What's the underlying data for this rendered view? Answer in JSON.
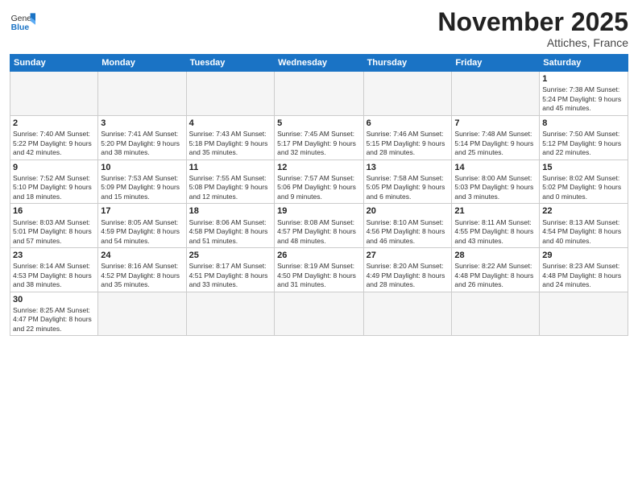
{
  "logo": {
    "text_general": "General",
    "text_blue": "Blue"
  },
  "header": {
    "month": "November 2025",
    "location": "Attiches, France"
  },
  "weekdays": [
    "Sunday",
    "Monday",
    "Tuesday",
    "Wednesday",
    "Thursday",
    "Friday",
    "Saturday"
  ],
  "weeks": [
    [
      {
        "day": "",
        "info": ""
      },
      {
        "day": "",
        "info": ""
      },
      {
        "day": "",
        "info": ""
      },
      {
        "day": "",
        "info": ""
      },
      {
        "day": "",
        "info": ""
      },
      {
        "day": "",
        "info": ""
      },
      {
        "day": "1",
        "info": "Sunrise: 7:38 AM\nSunset: 5:24 PM\nDaylight: 9 hours and 45 minutes."
      }
    ],
    [
      {
        "day": "2",
        "info": "Sunrise: 7:40 AM\nSunset: 5:22 PM\nDaylight: 9 hours and 42 minutes."
      },
      {
        "day": "3",
        "info": "Sunrise: 7:41 AM\nSunset: 5:20 PM\nDaylight: 9 hours and 38 minutes."
      },
      {
        "day": "4",
        "info": "Sunrise: 7:43 AM\nSunset: 5:18 PM\nDaylight: 9 hours and 35 minutes."
      },
      {
        "day": "5",
        "info": "Sunrise: 7:45 AM\nSunset: 5:17 PM\nDaylight: 9 hours and 32 minutes."
      },
      {
        "day": "6",
        "info": "Sunrise: 7:46 AM\nSunset: 5:15 PM\nDaylight: 9 hours and 28 minutes."
      },
      {
        "day": "7",
        "info": "Sunrise: 7:48 AM\nSunset: 5:14 PM\nDaylight: 9 hours and 25 minutes."
      },
      {
        "day": "8",
        "info": "Sunrise: 7:50 AM\nSunset: 5:12 PM\nDaylight: 9 hours and 22 minutes."
      }
    ],
    [
      {
        "day": "9",
        "info": "Sunrise: 7:52 AM\nSunset: 5:10 PM\nDaylight: 9 hours and 18 minutes."
      },
      {
        "day": "10",
        "info": "Sunrise: 7:53 AM\nSunset: 5:09 PM\nDaylight: 9 hours and 15 minutes."
      },
      {
        "day": "11",
        "info": "Sunrise: 7:55 AM\nSunset: 5:08 PM\nDaylight: 9 hours and 12 minutes."
      },
      {
        "day": "12",
        "info": "Sunrise: 7:57 AM\nSunset: 5:06 PM\nDaylight: 9 hours and 9 minutes."
      },
      {
        "day": "13",
        "info": "Sunrise: 7:58 AM\nSunset: 5:05 PM\nDaylight: 9 hours and 6 minutes."
      },
      {
        "day": "14",
        "info": "Sunrise: 8:00 AM\nSunset: 5:03 PM\nDaylight: 9 hours and 3 minutes."
      },
      {
        "day": "15",
        "info": "Sunrise: 8:02 AM\nSunset: 5:02 PM\nDaylight: 9 hours and 0 minutes."
      }
    ],
    [
      {
        "day": "16",
        "info": "Sunrise: 8:03 AM\nSunset: 5:01 PM\nDaylight: 8 hours and 57 minutes."
      },
      {
        "day": "17",
        "info": "Sunrise: 8:05 AM\nSunset: 4:59 PM\nDaylight: 8 hours and 54 minutes."
      },
      {
        "day": "18",
        "info": "Sunrise: 8:06 AM\nSunset: 4:58 PM\nDaylight: 8 hours and 51 minutes."
      },
      {
        "day": "19",
        "info": "Sunrise: 8:08 AM\nSunset: 4:57 PM\nDaylight: 8 hours and 48 minutes."
      },
      {
        "day": "20",
        "info": "Sunrise: 8:10 AM\nSunset: 4:56 PM\nDaylight: 8 hours and 46 minutes."
      },
      {
        "day": "21",
        "info": "Sunrise: 8:11 AM\nSunset: 4:55 PM\nDaylight: 8 hours and 43 minutes."
      },
      {
        "day": "22",
        "info": "Sunrise: 8:13 AM\nSunset: 4:54 PM\nDaylight: 8 hours and 40 minutes."
      }
    ],
    [
      {
        "day": "23",
        "info": "Sunrise: 8:14 AM\nSunset: 4:53 PM\nDaylight: 8 hours and 38 minutes."
      },
      {
        "day": "24",
        "info": "Sunrise: 8:16 AM\nSunset: 4:52 PM\nDaylight: 8 hours and 35 minutes."
      },
      {
        "day": "25",
        "info": "Sunrise: 8:17 AM\nSunset: 4:51 PM\nDaylight: 8 hours and 33 minutes."
      },
      {
        "day": "26",
        "info": "Sunrise: 8:19 AM\nSunset: 4:50 PM\nDaylight: 8 hours and 31 minutes."
      },
      {
        "day": "27",
        "info": "Sunrise: 8:20 AM\nSunset: 4:49 PM\nDaylight: 8 hours and 28 minutes."
      },
      {
        "day": "28",
        "info": "Sunrise: 8:22 AM\nSunset: 4:48 PM\nDaylight: 8 hours and 26 minutes."
      },
      {
        "day": "29",
        "info": "Sunrise: 8:23 AM\nSunset: 4:48 PM\nDaylight: 8 hours and 24 minutes."
      }
    ],
    [
      {
        "day": "30",
        "info": "Sunrise: 8:25 AM\nSunset: 4:47 PM\nDaylight: 8 hours and 22 minutes."
      },
      {
        "day": "",
        "info": ""
      },
      {
        "day": "",
        "info": ""
      },
      {
        "day": "",
        "info": ""
      },
      {
        "day": "",
        "info": ""
      },
      {
        "day": "",
        "info": ""
      },
      {
        "day": "",
        "info": ""
      }
    ]
  ]
}
